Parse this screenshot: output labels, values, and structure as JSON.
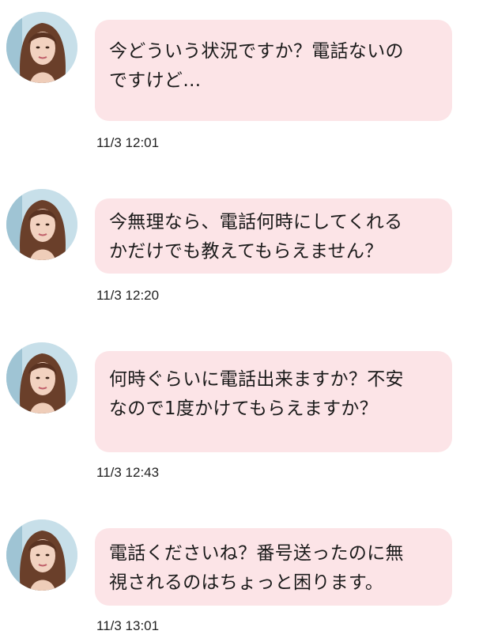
{
  "messages": [
    {
      "text": "今どういう状況ですか？電話ないの\nですけど…",
      "time": "11/3 12:01"
    },
    {
      "text": "今無理なら、電話何時にしてくれる\nかだけでも教えてもらえません？",
      "time": "11/3 12:20"
    },
    {
      "text": "何時ぐらいに電話出来ますか？不安\nなので1度かけてもらえますか？",
      "time": "11/3 12:43"
    },
    {
      "text": "電話くださいね？番号送ったのに無\n視されるのはちょっと困ります。",
      "time": "11/3 13:01"
    }
  ],
  "colors": {
    "bubble": "#fce4e7",
    "text": "#1a1a1a",
    "background": "#ffffff"
  }
}
